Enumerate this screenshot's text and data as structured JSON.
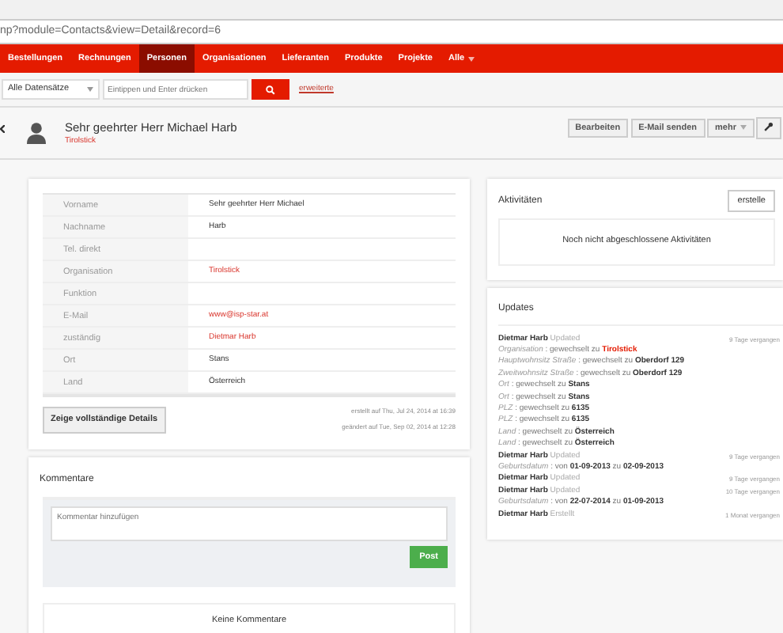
{
  "address_bar": {
    "url": "np?module=Contacts&view=Detail&record=6"
  },
  "nav": [
    {
      "label": "Bestellungen",
      "selected": false
    },
    {
      "label": "Rechnungen",
      "selected": false
    },
    {
      "label": "Personen",
      "selected": true
    },
    {
      "label": "Organisationen",
      "selected": false
    },
    {
      "label": "Lieferanten",
      "selected": false
    },
    {
      "label": "Produkte",
      "selected": false
    },
    {
      "label": "Projekte",
      "selected": false
    },
    {
      "label": "Alle",
      "selected": false,
      "dropdown": true
    }
  ],
  "search": {
    "scope": "Alle Datensätze",
    "placeholder": "Eintippen und Enter drücken",
    "advanced": "erweiterte"
  },
  "record": {
    "name": "Sehr geehrter Herr Michael Harb",
    "organisation": "Tirolstick"
  },
  "actions": [
    {
      "label": "Bearbeiten"
    },
    {
      "label": "E-Mail senden"
    },
    {
      "label": "mehr",
      "dropdown": true
    }
  ],
  "details": {
    "fields": [
      {
        "label": "Vorname",
        "value": "Sehr geehrter Herr Michael",
        "kind": "text"
      },
      {
        "label": "Nachname",
        "value": "Harb",
        "kind": "text"
      },
      {
        "label": "Tel. direkt",
        "kind": "text"
      },
      {
        "label": "Organisation",
        "value": "Tirolstick",
        "kind": "link"
      },
      {
        "label": "Funktion",
        "kind": "text"
      },
      {
        "label": "E-Mail",
        "value": "www@isp-star.at",
        "kind": "link"
      },
      {
        "label": "zuständig",
        "value": "Dietmar Harb",
        "kind": "link"
      },
      {
        "label": "Ort",
        "value": "Stans",
        "kind": "text"
      },
      {
        "label": "Land",
        "value": "Österreich",
        "kind": "text"
      }
    ],
    "show_all_button": "Zeige vollständige Details",
    "created": "erstellt auf Thu, Jul 24, 2014 at 16:39",
    "modified": "geändert auf Tue, Sep 02, 2014 at 12:28"
  },
  "comments": {
    "title": "Kommentare",
    "placeholder": "Kommentar hinzufügen",
    "post_button": "Post",
    "empty": "Keine Kommentare"
  },
  "activities": {
    "title": "Aktivitäten",
    "create_button": "erstelle",
    "empty": "Noch nicht abgeschlossene Aktivitäten"
  },
  "updates": {
    "title": "Updates",
    "entries": [
      {
        "author": "Dietmar Harb",
        "action": "Updated",
        "time": "9 Tage vergangen",
        "changes": [
          {
            "field": "Organisation",
            "text": ": gewechselt zu",
            "link": "Tirolstick"
          },
          {
            "field": "Hauptwohnsitz Straße",
            "text": ": gewechselt zu **Oberdorf 129**"
          },
          {
            "field": "Zweitwohnsitz Straße",
            "text": ": gewechselt zu **Oberdorf 129**"
          },
          {
            "field": "Ort",
            "text": ": gewechselt zu **Stans**"
          },
          {
            "field": "Ort",
            "text": ": gewechselt zu **Stans**"
          },
          {
            "field": "PLZ",
            "text": ": gewechselt zu **6135**"
          },
          {
            "field": "PLZ",
            "text": ": gewechselt zu **6135**"
          },
          {
            "field": "Land",
            "text": ": gewechselt zu **Österreich**"
          },
          {
            "field": "Land",
            "text": ": gewechselt zu **Österreich**"
          }
        ]
      },
      {
        "author": "Dietmar Harb",
        "action": "Updated",
        "time": "9 Tage vergangen",
        "changes": [
          {
            "field": "Geburtsdatum",
            "text": ": von **01-09-2013** zu **02-09-2013**"
          }
        ]
      },
      {
        "author": "Dietmar Harb",
        "action": "Updated",
        "time": "9 Tage vergangen"
      },
      {
        "author": "Dietmar Harb",
        "action": "Updated",
        "time": "10 Tage vergangen",
        "changes": [
          {
            "field": "Geburtsdatum",
            "text": ": von **22-07-2014** zu **01-09-2013**"
          }
        ]
      },
      {
        "author": "Dietmar Harb",
        "action": "Erstellt",
        "time": "1 Monat vergangen"
      }
    ]
  }
}
